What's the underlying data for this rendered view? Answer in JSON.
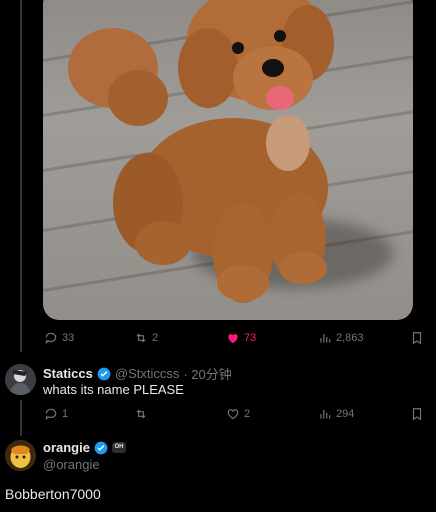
{
  "original_post": {
    "stats": {
      "replies": "33",
      "retweets": "2",
      "likes": "73",
      "views": "2,863"
    }
  },
  "reply1": {
    "display_name": "Staticcs",
    "handle": "@Stxticcss",
    "time": "· 20分钟",
    "text": "whats its name PLEASE",
    "stats": {
      "replies": "1",
      "retweets": "",
      "likes": "2",
      "views": "294"
    }
  },
  "reply2": {
    "display_name": "orangie",
    "badge": "OH",
    "handle": "@orangie",
    "text": "Bobberton7000"
  },
  "colors": {
    "accent": "#1d9bf0",
    "like": "#f91880",
    "muted": "#71767b",
    "text": "#e7e9ea"
  }
}
